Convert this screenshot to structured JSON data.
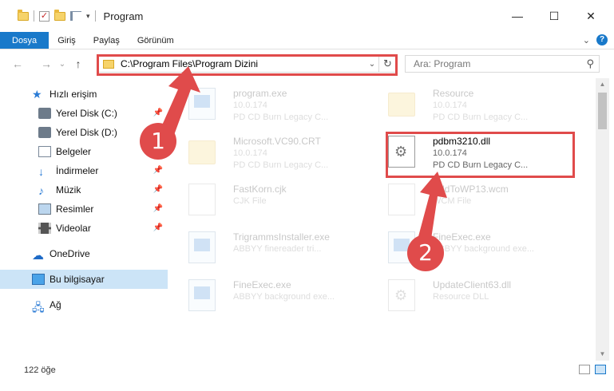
{
  "window": {
    "title": "Program",
    "minimize": "—",
    "maximize": "☐",
    "close": "✕"
  },
  "ribbon": {
    "tabs": [
      "Dosya",
      "Giriş",
      "Paylaş",
      "Görünüm"
    ],
    "expand": "⌄",
    "help": "?"
  },
  "nav": {
    "back": "←",
    "forward": "→",
    "recent": "⌄",
    "up": "↑",
    "address": "C:\\Program Files\\Program Dizini",
    "dropdown": "⌄",
    "refresh": "↻",
    "search_placeholder": "Ara: Program",
    "search_icon": "⚲"
  },
  "sidebar": {
    "items": [
      {
        "label": "Hızlı erişim",
        "icon": "star-icon"
      },
      {
        "label": "Yerel Disk (C:)",
        "icon": "drive-icon",
        "pin": "📌"
      },
      {
        "label": "Yerel Disk (D:)",
        "icon": "drive-icon",
        "pin": "📌"
      },
      {
        "label": "Belgeler",
        "icon": "documents-icon",
        "pin": "📌"
      },
      {
        "label": "İndirmeler",
        "icon": "download-icon",
        "pin": "📌"
      },
      {
        "label": "Müzik",
        "icon": "music-icon",
        "pin": "📌"
      },
      {
        "label": "Resimler",
        "icon": "pictures-icon",
        "pin": "📌"
      },
      {
        "label": "Videolar",
        "icon": "videos-icon",
        "pin": "📌"
      },
      {
        "label": "OneDrive",
        "icon": "onedrive-icon"
      },
      {
        "label": "Bu bilgisayar",
        "icon": "this-pc-icon"
      },
      {
        "label": "Ağ",
        "icon": "network-icon"
      }
    ]
  },
  "files": [
    {
      "name": "program.exe",
      "line1": "10.0.174",
      "line2": "PD CD Burn Legacy C...",
      "kind": "app"
    },
    {
      "name": "Resource",
      "line1": "10.0.174",
      "line2": "PD CD Burn Legacy C...",
      "kind": "folder"
    },
    {
      "name": "Microsoft.VC90.CRT",
      "line1": "10.0.174",
      "line2": "PD CD Burn Legacy C...",
      "kind": "folder"
    },
    {
      "name": "pdbm3210.dll",
      "line1": "10.0.174",
      "line2": "PD CD Burn Legacy C...",
      "kind": "dll"
    },
    {
      "name": "FastKorn.cjk",
      "line1": "CJK File",
      "line2": "",
      "kind": "file"
    },
    {
      "name": "AddToWP13.wcm",
      "line1": "WCM File",
      "line2": "",
      "kind": "file"
    },
    {
      "name": "TrigrammsInstaller.exe",
      "line1": "ABBYY finereader tri...",
      "line2": "",
      "kind": "app"
    },
    {
      "name": "FineExec.exe",
      "line1": "ABBYY background exe...",
      "line2": "",
      "kind": "app"
    },
    {
      "name": "FineExec.exe",
      "line1": "ABBYY background exe...",
      "line2": "",
      "kind": "app"
    },
    {
      "name": "UpdateClient63.dll",
      "line1": "Resource DLL",
      "line2": "",
      "kind": "dll"
    }
  ],
  "gear_glyph": "⚙",
  "status": {
    "item_count": "122 öğe"
  },
  "annotations": {
    "badge1": "1",
    "badge2": "2",
    "color": "#e04b4b"
  },
  "scroll": {
    "up": "▲",
    "down": "▼"
  }
}
